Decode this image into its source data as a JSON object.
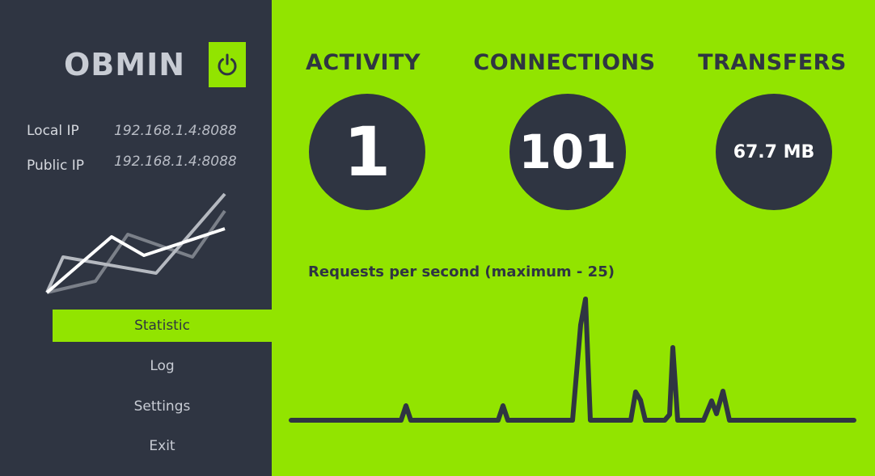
{
  "sidebar": {
    "app_name": "OBMIN",
    "power_icon": "power-icon",
    "local_ip_label": "Local IP",
    "local_ip_value": "192.168.1.4:8088",
    "public_ip_label": "Public IP",
    "public_ip_value": "192.168.1.4:8088",
    "menu": [
      {
        "label": "Statistic",
        "active": true
      },
      {
        "label": "Log",
        "active": false
      },
      {
        "label": "Settings",
        "active": false
      },
      {
        "label": "Exit",
        "active": false
      }
    ]
  },
  "stats": {
    "activity": {
      "title": "ACTIVITY",
      "value": "1"
    },
    "connections": {
      "title": "CONNECTIONS",
      "value": "101"
    },
    "transfers": {
      "title": "TRANSFERS",
      "value": "67.7 MB"
    }
  },
  "graph": {
    "title": "Requests per second (maximum - 25)"
  },
  "colors": {
    "accent": "#92e400",
    "dark": "#2f3542",
    "text_light": "#c8ccd4"
  }
}
